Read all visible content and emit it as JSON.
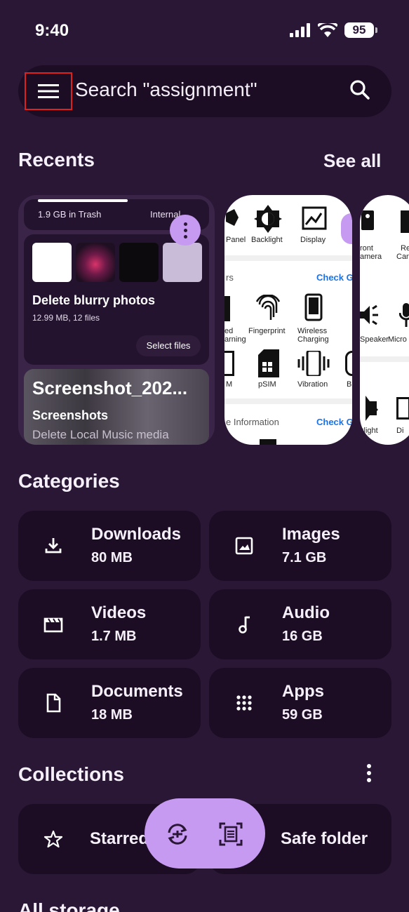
{
  "status": {
    "time": "9:40",
    "battery": "95"
  },
  "search": {
    "placeholder": "Search \"assignment\""
  },
  "recents": {
    "title": "Recents",
    "see_all": "See all",
    "card1": {
      "trash": "1.9 GB in Trash",
      "internal": "Internal",
      "title": "Delete blurry photos",
      "subtitle": "12.99 MB, 12 files",
      "select_files": "Select files",
      "screenshot_name": "Screenshot_202...",
      "folder": "Screenshots",
      "delete_text": "Delete Local Music media"
    },
    "card2": {
      "panel": "Panel",
      "backlight": "Backlight",
      "display": "Display",
      "section_prefix": "rs",
      "check": "Check G",
      "fingerprint": "Fingerprint",
      "wireless": "Wireless",
      "charging": "Charging",
      "ed": "ed",
      "arning": "arning",
      "m": "M",
      "psim": "pSIM",
      "vibration": "Vibration",
      "b": "B",
      "info": "e Information",
      "check2": "Check G"
    },
    "card3": {
      "front": "ront",
      "camera": "amera",
      "re": "Re",
      "can": "Can",
      "speaker": "Speaker",
      "micro": "Micro",
      "klight": "klight",
      "di": "Di"
    }
  },
  "categories": {
    "title": "Categories",
    "items": [
      {
        "name": "Downloads",
        "size": "80 MB",
        "icon": "download-icon"
      },
      {
        "name": "Images",
        "size": "7.1 GB",
        "icon": "image-icon"
      },
      {
        "name": "Videos",
        "size": "1.7 MB",
        "icon": "video-icon"
      },
      {
        "name": "Audio",
        "size": "16 GB",
        "icon": "music-note-icon"
      },
      {
        "name": "Documents",
        "size": "18 MB",
        "icon": "document-icon"
      },
      {
        "name": "Apps",
        "size": "59 GB",
        "icon": "apps-grid-icon"
      }
    ]
  },
  "collections": {
    "title": "Collections",
    "starred": "Starred",
    "safe_folder": "Safe folder"
  },
  "all_storage": {
    "title": "All storage"
  },
  "colors": {
    "background": "#2a1736",
    "card": "#1c0d25",
    "accent": "#c79af2"
  }
}
